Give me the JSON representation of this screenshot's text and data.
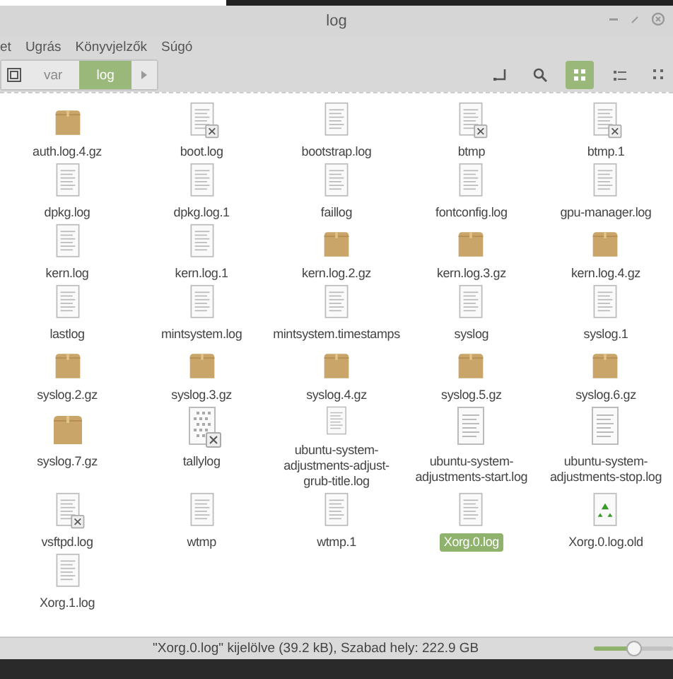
{
  "window": {
    "title": "log"
  },
  "menu": [
    "et",
    "Ugrás",
    "Könyvjelzők",
    "Súgó"
  ],
  "breadcrumbs": [
    {
      "label": "var",
      "selected": false
    },
    {
      "label": "log",
      "selected": true
    }
  ],
  "views": [
    {
      "kind": "grid",
      "selected": true
    },
    {
      "kind": "list",
      "selected": false
    },
    {
      "kind": "compact",
      "selected": false
    }
  ],
  "files": [
    {
      "name": "auth.log.4.gz",
      "kind": "archive",
      "locked": false,
      "selected": false
    },
    {
      "name": "boot.log",
      "kind": "text",
      "locked": true,
      "selected": false
    },
    {
      "name": "bootstrap.log",
      "kind": "text",
      "locked": false,
      "selected": false
    },
    {
      "name": "btmp",
      "kind": "text",
      "locked": true,
      "selected": false
    },
    {
      "name": "btmp.1",
      "kind": "text",
      "locked": true,
      "selected": false
    },
    {
      "name": "dpkg.log",
      "kind": "text",
      "locked": false,
      "selected": false
    },
    {
      "name": "dpkg.log.1",
      "kind": "text",
      "locked": false,
      "selected": false
    },
    {
      "name": "faillog",
      "kind": "text",
      "locked": false,
      "selected": false
    },
    {
      "name": "fontconfig.log",
      "kind": "text",
      "locked": false,
      "selected": false
    },
    {
      "name": "gpu-manager.log",
      "kind": "text",
      "locked": false,
      "selected": false
    },
    {
      "name": "kern.log",
      "kind": "text",
      "locked": false,
      "selected": false
    },
    {
      "name": "kern.log.1",
      "kind": "text",
      "locked": false,
      "selected": false
    },
    {
      "name": "kern.log.2.gz",
      "kind": "archive",
      "locked": false,
      "selected": false
    },
    {
      "name": "kern.log.3.gz",
      "kind": "archive",
      "locked": false,
      "selected": false
    },
    {
      "name": "kern.log.4.gz",
      "kind": "archive",
      "locked": false,
      "selected": false
    },
    {
      "name": "lastlog",
      "kind": "text",
      "locked": false,
      "selected": false
    },
    {
      "name": "mintsystem.log",
      "kind": "text",
      "locked": false,
      "selected": false
    },
    {
      "name": "mintsystem.timestamps",
      "kind": "text",
      "locked": false,
      "selected": false
    },
    {
      "name": "syslog",
      "kind": "text",
      "locked": false,
      "selected": false
    },
    {
      "name": "syslog.1",
      "kind": "text",
      "locked": false,
      "selected": false
    },
    {
      "name": "syslog.2.gz",
      "kind": "archive",
      "locked": false,
      "selected": false
    },
    {
      "name": "syslog.3.gz",
      "kind": "archive",
      "locked": false,
      "selected": false
    },
    {
      "name": "syslog.4.gz",
      "kind": "archive",
      "locked": false,
      "selected": false
    },
    {
      "name": "syslog.5.gz",
      "kind": "archive",
      "locked": false,
      "selected": false
    },
    {
      "name": "syslog.6.gz",
      "kind": "archive",
      "locked": false,
      "selected": false
    },
    {
      "name": "syslog.7.gz",
      "kind": "archive",
      "locked": false,
      "selected": false
    },
    {
      "name": "tallylog",
      "kind": "binary",
      "locked": true,
      "selected": false
    },
    {
      "name": "ubuntu-system-adjustments-adjust-grub-title.log",
      "kind": "text",
      "locked": false,
      "selected": false
    },
    {
      "name": "ubuntu-system-adjustments-start.log",
      "kind": "text",
      "locked": false,
      "selected": false
    },
    {
      "name": "ubuntu-system-adjustments-stop.log",
      "kind": "text",
      "locked": false,
      "selected": false
    },
    {
      "name": "vsftpd.log",
      "kind": "text",
      "locked": true,
      "selected": false
    },
    {
      "name": "wtmp",
      "kind": "text",
      "locked": false,
      "selected": false
    },
    {
      "name": "wtmp.1",
      "kind": "text",
      "locked": false,
      "selected": false
    },
    {
      "name": "Xorg.0.log",
      "kind": "text",
      "locked": false,
      "selected": true
    },
    {
      "name": "Xorg.0.log.old",
      "kind": "backup",
      "locked": false,
      "selected": false
    },
    {
      "name": "Xorg.1.log",
      "kind": "text",
      "locked": false,
      "selected": false
    }
  ],
  "status_bar": {
    "text": "\"Xorg.0.log\" kijelölve (39.2 kB), Szabad hely: 222.9 GB",
    "zoom": {
      "level": 0.5
    }
  }
}
